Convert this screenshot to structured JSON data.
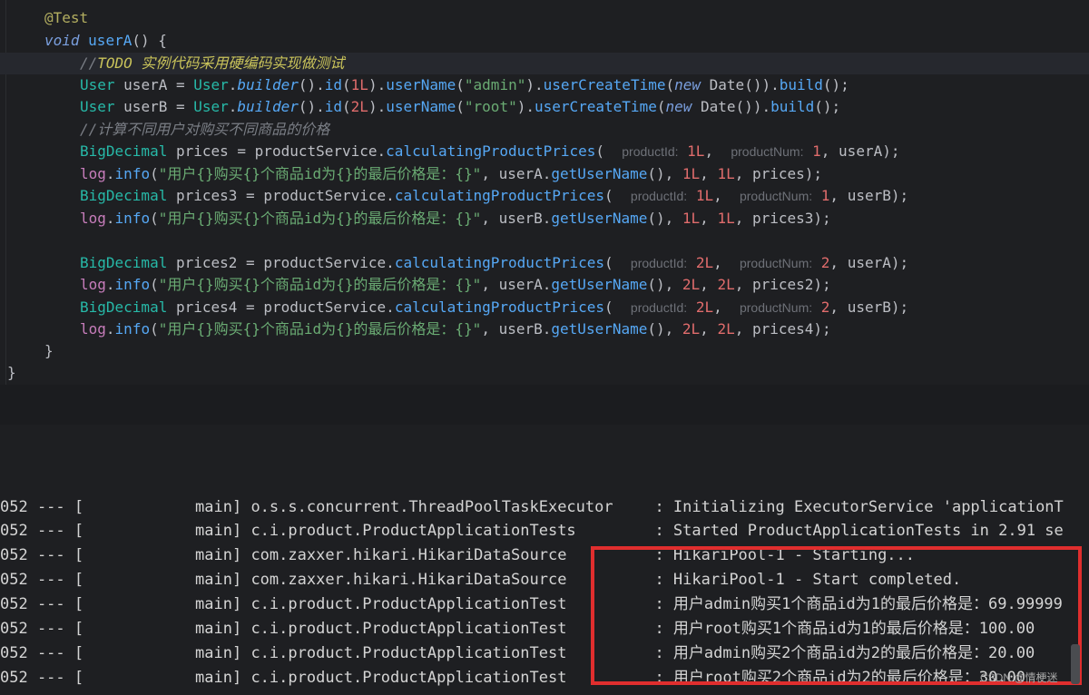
{
  "code": {
    "annotation": "@Test",
    "void_kw": "void",
    "method_name": "userA",
    "method_tail": "() {",
    "todo_prefix": "//",
    "todo_text": "TODO 实例代码采用硬编码实现做测试",
    "comment2": "//计算不同用户对购买不同商品的价格",
    "user_type": "User",
    "user_cls": "User",
    "builder": "builder",
    "id": "id",
    "userName": "userName",
    "userCreateTime": "userCreateTime",
    "new_kw": "new",
    "date": "Date",
    "build": "build",
    "userA_var": "userA",
    "userB_var": "userB",
    "id_a": "1L",
    "id_b": "2L",
    "name_a": "\"admin\"",
    "name_b": "\"root\"",
    "bigdecimal": "BigDecimal",
    "service": "productService",
    "calc": "calculatingProductPrices",
    "hint_pid": "productId:",
    "hint_pnum": "productNum:",
    "log": "log",
    "info": "info",
    "log_str": "\"用户{}购买{}个商品id为{}的最后价格是：{}\"",
    "getUserName": "getUserName",
    "calls": [
      {
        "var": "prices",
        "pid": "1L",
        "pnum": "1",
        "user": "userA"
      },
      {
        "var": "prices3",
        "pid": "1L",
        "pnum": "1",
        "user": "userB"
      },
      {
        "var": "prices2",
        "pid": "2L",
        "pnum": "2",
        "user": "userA"
      },
      {
        "var": "prices4",
        "pid": "2L",
        "pnum": "2",
        "user": "userB"
      }
    ],
    "logs": [
      {
        "user": "userA",
        "a": "1L",
        "b": "1L",
        "var": "prices"
      },
      {
        "user": "userB",
        "a": "1L",
        "b": "1L",
        "var": "prices3"
      },
      {
        "user": "userA",
        "a": "2L",
        "b": "2L",
        "var": "prices2"
      },
      {
        "user": "userB",
        "a": "2L",
        "b": "2L",
        "var": "prices4"
      }
    ],
    "close_method": "}",
    "close_class": "}"
  },
  "console": {
    "lines": [
      {
        "prefix": "052 --- [",
        "thread": "main]",
        "logger": "o.s.s.concurrent.ThreadPoolTaskExecutor ",
        "msg": ": Initializing ExecutorService 'applicationT"
      },
      {
        "prefix": "052 --- [",
        "thread": "main]",
        "logger": "c.i.product.ProductApplicationTests     ",
        "msg": ": Started ProductApplicationTests in 2.91 se"
      },
      {
        "prefix": "052 --- [",
        "thread": "main]",
        "logger": "com.zaxxer.hikari.HikariDataSource      ",
        "msg": ": HikariPool-1 - Starting..."
      },
      {
        "prefix": "052 --- [",
        "thread": "main]",
        "logger": "com.zaxxer.hikari.HikariDataSource      ",
        "msg": ": HikariPool-1 - Start completed."
      },
      {
        "prefix": "052 --- [",
        "thread": "main]",
        "logger": "c.i.product.ProductApplicationTest      ",
        "msg": ": 用户admin购买1个商品id为1的最后价格是：69.99999"
      },
      {
        "prefix": "052 --- [",
        "thread": "main]",
        "logger": "c.i.product.ProductApplicationTest      ",
        "msg": ": 用户root购买1个商品id为1的最后价格是：100.00"
      },
      {
        "prefix": "052 --- [",
        "thread": "main]",
        "logger": "c.i.product.ProductApplicationTest      ",
        "msg": ": 用户admin购买2个商品id为2的最后价格是：20.00"
      },
      {
        "prefix": "052 --- [",
        "thread": "main]",
        "logger": "c.i.product.ProductApplicationTest      ",
        "msg": ": 用户root购买2个商品id为2的最后价格是：30.00"
      }
    ]
  },
  "watermark": "CSDN @情梗迷"
}
